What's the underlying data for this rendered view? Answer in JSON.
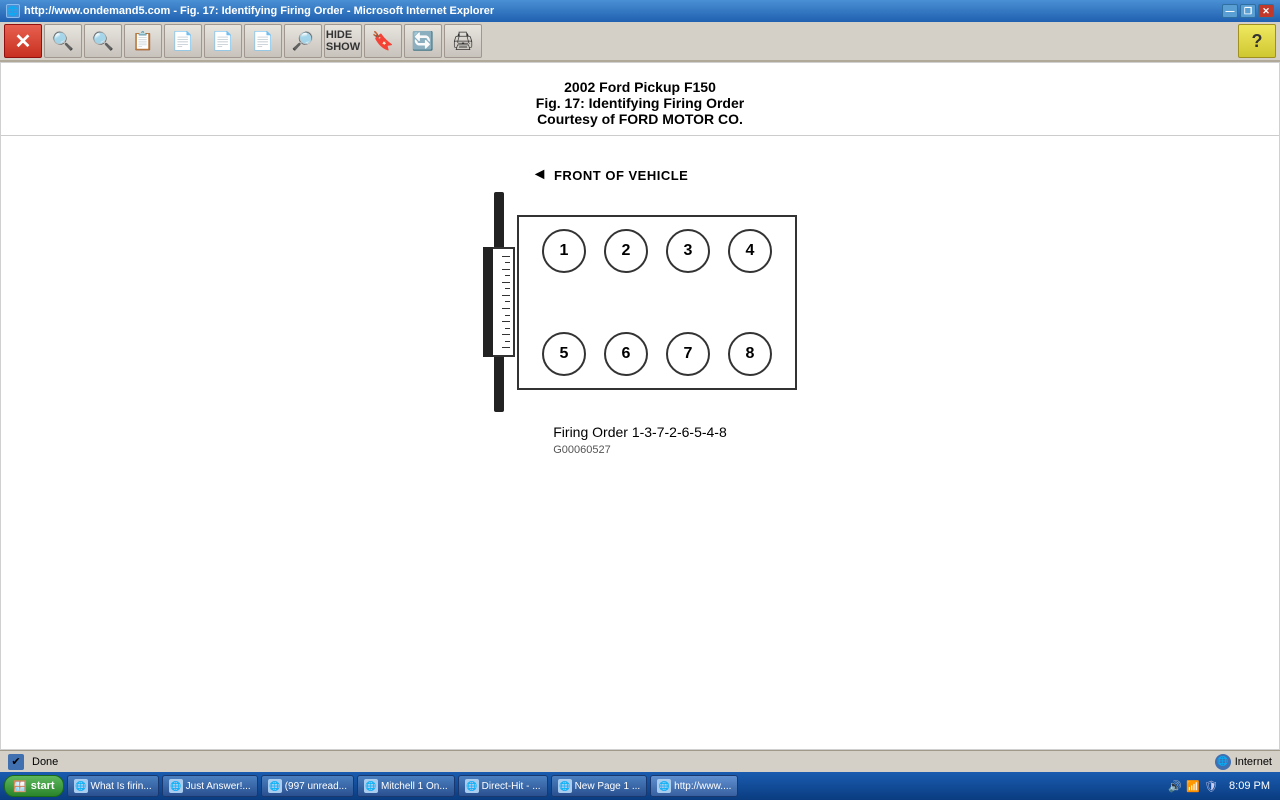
{
  "titleBar": {
    "title": "http://www.ondemand5.com - Fig. 17: Identifying Firing Order - Microsoft Internet Explorer",
    "icon": "🌐",
    "controls": {
      "minimize": "—",
      "restore": "❐",
      "close": "✕"
    }
  },
  "toolbar": {
    "buttons": [
      {
        "id": "close",
        "label": "✕",
        "type": "close"
      },
      {
        "id": "back",
        "label": "🔍"
      },
      {
        "id": "forward",
        "label": "🔍"
      },
      {
        "id": "fig-list",
        "label": "📋"
      },
      {
        "id": "prev",
        "label": "📄"
      },
      {
        "id": "next-fig",
        "label": "📄"
      },
      {
        "id": "jump",
        "label": "📄"
      },
      {
        "id": "find",
        "label": "🔎"
      },
      {
        "id": "hide-show",
        "label": "📑"
      },
      {
        "id": "bookmark",
        "label": "🔖"
      },
      {
        "id": "refresh",
        "label": "🔄"
      },
      {
        "id": "print",
        "label": "🖨"
      }
    ],
    "help": "?"
  },
  "header": {
    "line1": "2002 Ford Pickup F150",
    "line2": "Fig. 17: Identifying Firing Order",
    "line3": "Courtesy of FORD MOTOR CO."
  },
  "diagram": {
    "frontLabel": "FRONT OF VEHICLE",
    "cylinders": {
      "top": [
        "①",
        "②",
        "③",
        "④"
      ],
      "bottom": [
        "⑤",
        "⑥",
        "⑦",
        "⑧"
      ]
    },
    "caption": "Firing Order 1-3-7-2-6-5-4-8",
    "figureId": "G00060527"
  },
  "statusBar": {
    "status": "Done",
    "zone": "Internet"
  },
  "taskbar": {
    "startLabel": "start",
    "items": [
      {
        "id": "tab1",
        "label": "What Is firin...",
        "icon": "🌐"
      },
      {
        "id": "tab2",
        "label": "Just Answer!...",
        "icon": "🌐"
      },
      {
        "id": "tab3",
        "label": "(997 unread...",
        "icon": "🌐"
      },
      {
        "id": "tab4",
        "label": "Mitchell 1 On...",
        "icon": "🌐"
      },
      {
        "id": "tab5",
        "label": "Direct-Hit - ...",
        "icon": "🌐"
      },
      {
        "id": "tab6",
        "label": "New Page 1 ...",
        "icon": "🌐"
      },
      {
        "id": "tab7",
        "label": "http://www....",
        "icon": "🌐"
      }
    ],
    "time": "8:09 PM"
  }
}
